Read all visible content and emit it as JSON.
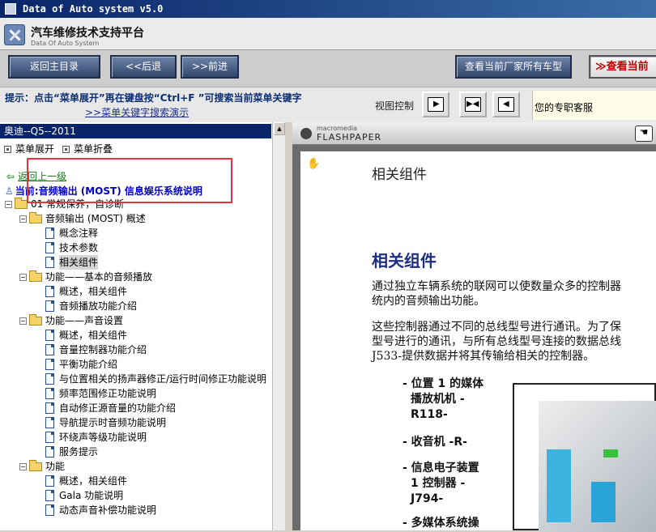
{
  "window": {
    "title": "Data of Auto system v5.0"
  },
  "header": {
    "title": "汽车维修技术支持平台",
    "subtitle": "Data Of Auto System"
  },
  "nav": {
    "back_main": "返回主目录",
    "back": "<<后退",
    "forward": ">>前进",
    "view_all_models": "查看当前厂家所有车型",
    "view_current": "查看当前"
  },
  "hint": {
    "text": "提示：点击“菜单展开”再在键盘按“Ctrl+F ”可搜索当前菜单关键字",
    "demo_link": ">>菜单关键字搜索演示",
    "view_control_label": "视图控制",
    "service": "您的专职客服"
  },
  "sidebar": {
    "car_header": "奥迪--Q5--2011",
    "expand": "菜单展开",
    "collapse": "菜单折叠",
    "back_link": "返回上一级",
    "current": "当前:音频输出 (MOST) 信息娱乐系统说明",
    "tree": [
      {
        "label": "01 常规保养，自诊断",
        "level": 0,
        "type": "folder"
      },
      {
        "label": "音频输出 (MOST) 概述",
        "level": 1,
        "type": "folder"
      },
      {
        "label": "概念注释",
        "level": 2,
        "type": "doc"
      },
      {
        "label": "技术参数",
        "level": 2,
        "type": "doc"
      },
      {
        "label": "相关组件",
        "level": 2,
        "type": "doc",
        "selected": true
      },
      {
        "label": "功能——基本的音频播放",
        "level": 1,
        "type": "folder"
      },
      {
        "label": "概述，相关组件",
        "level": 2,
        "type": "doc"
      },
      {
        "label": "音频播放功能介绍",
        "level": 2,
        "type": "doc"
      },
      {
        "label": "功能——声音设置",
        "level": 1,
        "type": "folder"
      },
      {
        "label": "概述，相关组件",
        "level": 2,
        "type": "doc"
      },
      {
        "label": "音量控制器功能介绍",
        "level": 2,
        "type": "doc"
      },
      {
        "label": "平衡功能介绍",
        "level": 2,
        "type": "doc"
      },
      {
        "label": "与位置相关的扬声器修正/运行时间修正功能说明",
        "level": 2,
        "type": "doc"
      },
      {
        "label": "频率范围修正功能说明",
        "level": 2,
        "type": "doc"
      },
      {
        "label": "自动修正源音量的功能介绍",
        "level": 2,
        "type": "doc"
      },
      {
        "label": "导航提示时音频功能说明",
        "level": 2,
        "type": "doc"
      },
      {
        "label": "环绕声等级功能说明",
        "level": 2,
        "type": "doc"
      },
      {
        "label": "服务提示",
        "level": 2,
        "type": "doc"
      },
      {
        "label": "功能",
        "level": 1,
        "type": "folder"
      },
      {
        "label": "概述，相关组件",
        "level": 2,
        "type": "doc"
      },
      {
        "label": "Gala 功能说明",
        "level": 2,
        "type": "doc"
      },
      {
        "label": "动态声音补偿功能说明",
        "level": 2,
        "type": "doc"
      }
    ]
  },
  "viewer": {
    "brand_small": "macromedia",
    "brand": "FLASHPAPER",
    "page_title": "相关组件",
    "heading": "相关组件",
    "para1": [
      "通过独立车辆系统的联网可以使数量众多的控制器",
      "统内的音频输出功能。"
    ],
    "para2": [
      "这些控制器通过不同的总线型号进行通讯。为了保",
      "型号进行的通讯，与所有总线型号连接的数据总线",
      "J533-提供数据并将其传输给相关的控制器。"
    ],
    "bullets": [
      [
        "- 位置 1 的媒体",
        "播放机机 -",
        "R118-"
      ],
      [
        "- 收音机 -R-"
      ],
      [
        "- 信息电子装置",
        "1 控制器 -",
        "J794-"
      ],
      [
        "- 多媒体系统操"
      ]
    ]
  }
}
